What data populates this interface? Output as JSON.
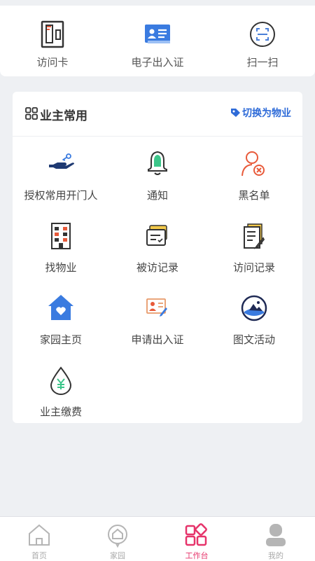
{
  "quick_actions": [
    {
      "label": "访问卡",
      "icon": "door-card-icon"
    },
    {
      "label": "电子出入证",
      "icon": "id-card-icon"
    },
    {
      "label": "扫一扫",
      "icon": "scan-icon"
    }
  ],
  "common": {
    "title": "业主常用",
    "title_icon": "grid-icon",
    "switch_label": "切换为物业",
    "switch_icon": "tag-icon",
    "items": [
      {
        "label": "授权常用开门人",
        "icon": "hand-key-icon"
      },
      {
        "label": "通知",
        "icon": "bell-icon"
      },
      {
        "label": "黑名单",
        "icon": "user-block-icon"
      },
      {
        "label": "找物业",
        "icon": "building-icon"
      },
      {
        "label": "被访记录",
        "icon": "visited-record-icon"
      },
      {
        "label": "访问记录",
        "icon": "visit-record-icon"
      },
      {
        "label": "家园主页",
        "icon": "home-heart-icon"
      },
      {
        "label": "申请出入证",
        "icon": "apply-pass-icon"
      },
      {
        "label": "图文活动",
        "icon": "activity-image-icon"
      },
      {
        "label": "业主缴费",
        "icon": "payment-drop-icon"
      }
    ]
  },
  "tabbar": [
    {
      "label": "首页",
      "icon": "home-icon",
      "active": false
    },
    {
      "label": "家园",
      "icon": "community-icon",
      "active": false
    },
    {
      "label": "工作台",
      "icon": "workbench-icon",
      "active": true
    },
    {
      "label": "我的",
      "icon": "profile-icon",
      "active": false
    }
  ],
  "colors": {
    "accent": "#e6336a",
    "link": "#2e6bd8",
    "background": "#eef0f3"
  }
}
